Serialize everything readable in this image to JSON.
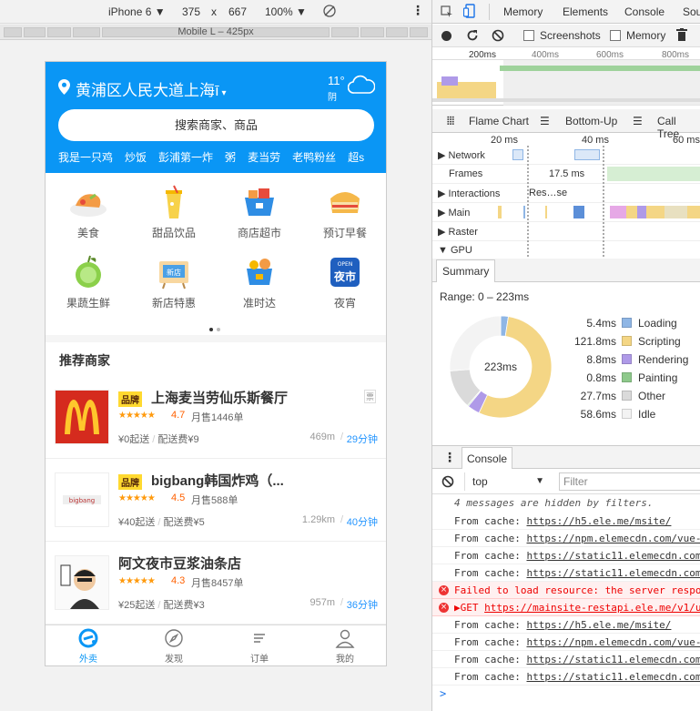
{
  "device_toolbar": {
    "device": "iPhone 6 ▼",
    "width": "375",
    "times": "x",
    "height": "667",
    "zoom": "100% ▼",
    "ruler_label": "Mobile L – 425px"
  },
  "app": {
    "location": "黄浦区人民大道上海ī",
    "weather_temp": "11°",
    "weather_desc": "阴",
    "search_placeholder": "搜索商家、商品",
    "hot_words": [
      "我是一只鸡",
      "炒饭",
      "彭浦第一炸",
      "粥",
      "麦当劳",
      "老鸭粉丝",
      "超s"
    ],
    "categories": [
      {
        "label": "美食",
        "icon": "food-icon"
      },
      {
        "label": "甜品饮品",
        "icon": "drink-icon"
      },
      {
        "label": "商店超市",
        "icon": "supermarket-icon"
      },
      {
        "label": "预订早餐",
        "icon": "breakfast-icon"
      },
      {
        "label": "果蔬生鲜",
        "icon": "fruit-icon"
      },
      {
        "label": "新店特惠",
        "icon": "new-store-icon"
      },
      {
        "label": "准时达",
        "icon": "ontime-icon"
      },
      {
        "label": "夜宵",
        "icon": "night-icon"
      }
    ],
    "night_badge_top": "OPEN",
    "night_badge_text": "夜市",
    "new_store_badge": "新店",
    "recommend_title": "推荐商家",
    "brand_label": "品牌",
    "shops": [
      {
        "name": "上海麦当劳仙乐斯餐厅",
        "brand": true,
        "stars": "★★★★★",
        "rating": "4.7",
        "sold": "月售1446单",
        "min_order": "¥0起送",
        "delivery_fee": "配送费¥9",
        "distance": "469m",
        "time": "29分钟",
        "ticket": "票"
      },
      {
        "name": "bigbang韩国炸鸡（...",
        "brand": true,
        "stars": "★★★★★",
        "rating": "4.5",
        "sold": "月售588单",
        "min_order": "¥40起送",
        "delivery_fee": "配送费¥5",
        "distance": "1.29km",
        "time": "40分钟"
      },
      {
        "name": "阿文夜市豆浆油条店",
        "brand": false,
        "stars": "★★★★★",
        "rating": "4.3",
        "sold": "月售8457单",
        "min_order": "¥25起送",
        "delivery_fee": "配送费¥3",
        "distance": "957m",
        "time": "36分钟"
      }
    ],
    "tabs": [
      {
        "label": "外卖",
        "icon": "waimai-icon",
        "active": true
      },
      {
        "label": "发现",
        "icon": "compass-icon",
        "active": false
      },
      {
        "label": "订单",
        "icon": "order-icon",
        "active": false
      },
      {
        "label": "我的",
        "icon": "user-icon",
        "active": false
      }
    ]
  },
  "devtools": {
    "tabs": [
      "Memory",
      "Elements",
      "Console",
      "Sou"
    ],
    "screenshots_label": "Screenshots",
    "memory_label": "Memory",
    "overview_ticks": [
      "200ms",
      "400ms",
      "600ms",
      "800ms"
    ],
    "detail_tabs": [
      "Flame Chart",
      "Bottom-Up",
      "Call Tree"
    ],
    "timeline_ticks": [
      "20 ms",
      "40 ms",
      "60 ms"
    ],
    "tracks": [
      "Network",
      "Frames",
      "Interactions",
      "Main",
      "Raster",
      "GPU"
    ],
    "frame_label": "17.5 ms",
    "interaction_label": "Res…se",
    "summary_tab": "Summary",
    "range": "Range: 0 – 223ms",
    "total": "223ms",
    "console_tab": "Console",
    "context": "top",
    "filter_placeholder": "Filter",
    "hidden_note": "4 messages are hidden by filters.",
    "messages": [
      {
        "type": "log",
        "prefix": "From cache:",
        "url": "https://h5.ele.me/msite/"
      },
      {
        "type": "log",
        "prefix": "From cache:",
        "url": "https://npm.elemecdn.com/vue-"
      },
      {
        "type": "log",
        "prefix": "From cache:",
        "url": "https://static11.elemecdn.com"
      },
      {
        "type": "log",
        "prefix": "From cache:",
        "url": "https://static11.elemecdn.com"
      },
      {
        "type": "error",
        "prefix": "Failed to load resource: the server respo",
        "url": ""
      },
      {
        "type": "error",
        "prefix": "▶GET",
        "url": "https://mainsite-restapi.ele.me/v1/u"
      },
      {
        "type": "log",
        "prefix": "From cache:",
        "url": "https://h5.ele.me/msite/"
      },
      {
        "type": "log",
        "prefix": "From cache:",
        "url": "https://npm.elemecdn.com/vue-"
      },
      {
        "type": "log",
        "prefix": "From cache:",
        "url": "https://static11.elemecdn.com"
      },
      {
        "type": "log",
        "prefix": "From cache:",
        "url": "https://static11.elemecdn.com"
      }
    ],
    "prompt": ">"
  },
  "chart_data": {
    "type": "pie",
    "title": "",
    "categories": [
      "Loading",
      "Scripting",
      "Rendering",
      "Painting",
      "Other",
      "Idle"
    ],
    "values": [
      5.4,
      121.8,
      8.8,
      0.8,
      27.7,
      58.6
    ],
    "value_labels": [
      "5.4ms",
      "121.8ms",
      "8.8ms",
      "0.8ms",
      "27.7ms",
      "58.6ms"
    ],
    "colors": [
      "#8fb6e5",
      "#f4d685",
      "#af9ae8",
      "#8ec98b",
      "#dadada",
      "#f3f3f3"
    ],
    "center_label": "223ms",
    "legend": "right"
  }
}
